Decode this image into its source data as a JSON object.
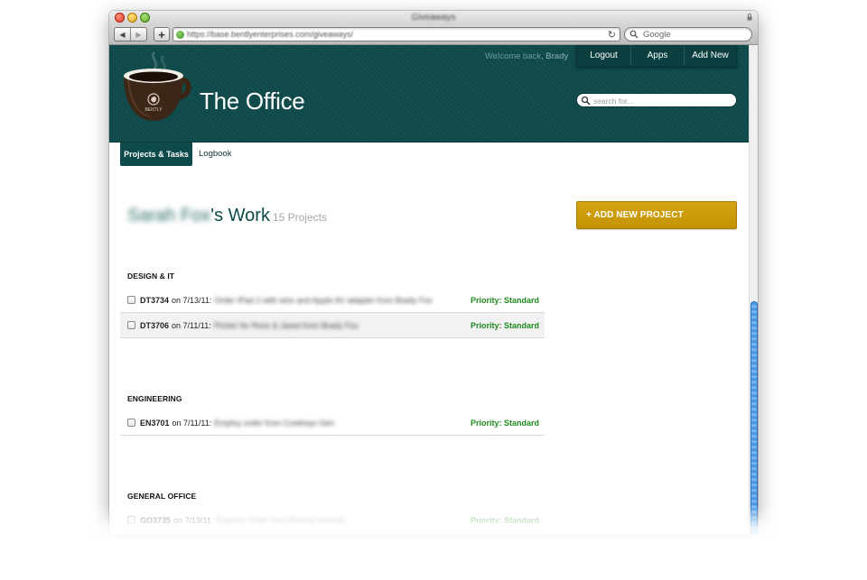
{
  "window": {
    "title": "Giveaways"
  },
  "toolbar": {
    "url": "https://base.bentlyenterprises.com/giveaways/",
    "search_placeholder": "Google"
  },
  "header": {
    "welcome_prefix": "Welcome back,",
    "user_name": "Brady",
    "nav": [
      "Logout",
      "Apps",
      "Add New"
    ],
    "site_title": "The Office",
    "search_placeholder": "search for...",
    "logo_text": "BENTLY"
  },
  "tabs": [
    {
      "label": "Projects & Tasks",
      "active": true
    },
    {
      "label": "Logbook",
      "active": false
    }
  ],
  "work": {
    "owner": "Sarah Fox",
    "suffix": "'s Work",
    "count_label": "15 Projects",
    "add_button": "+ ADD NEW PROJECT"
  },
  "sections": [
    {
      "title": "DESIGN & IT",
      "rows": [
        {
          "code": "DT3734",
          "on": "on 7/13/11:",
          "desc": "Order iPad 2 with wire and Apple AV adapter from Brady Fox",
          "priority": "Priority: Standard"
        },
        {
          "code": "DT3706",
          "on": "on 7/11/11:",
          "desc": "Printer for Ross & Jared from Brady Fox",
          "priority": "Priority: Standard"
        }
      ]
    },
    {
      "title": "ENGINEERING",
      "rows": [
        {
          "code": "EN3701",
          "on": "on 7/11/11:",
          "desc": "Employ order from Cowboys Gen",
          "priority": "Priority: Standard"
        }
      ]
    },
    {
      "title": "GENERAL OFFICE",
      "rows": [
        {
          "code": "GO3735",
          "on": "on 7/13/11:",
          "desc": "Express Order from Beauty Animals",
          "priority": "Priority: Standard"
        }
      ]
    }
  ],
  "colors": {
    "brand_teal": "#0e4a4a",
    "accent_gold": "#d4a414",
    "priority_green": "#1e8a1e"
  }
}
